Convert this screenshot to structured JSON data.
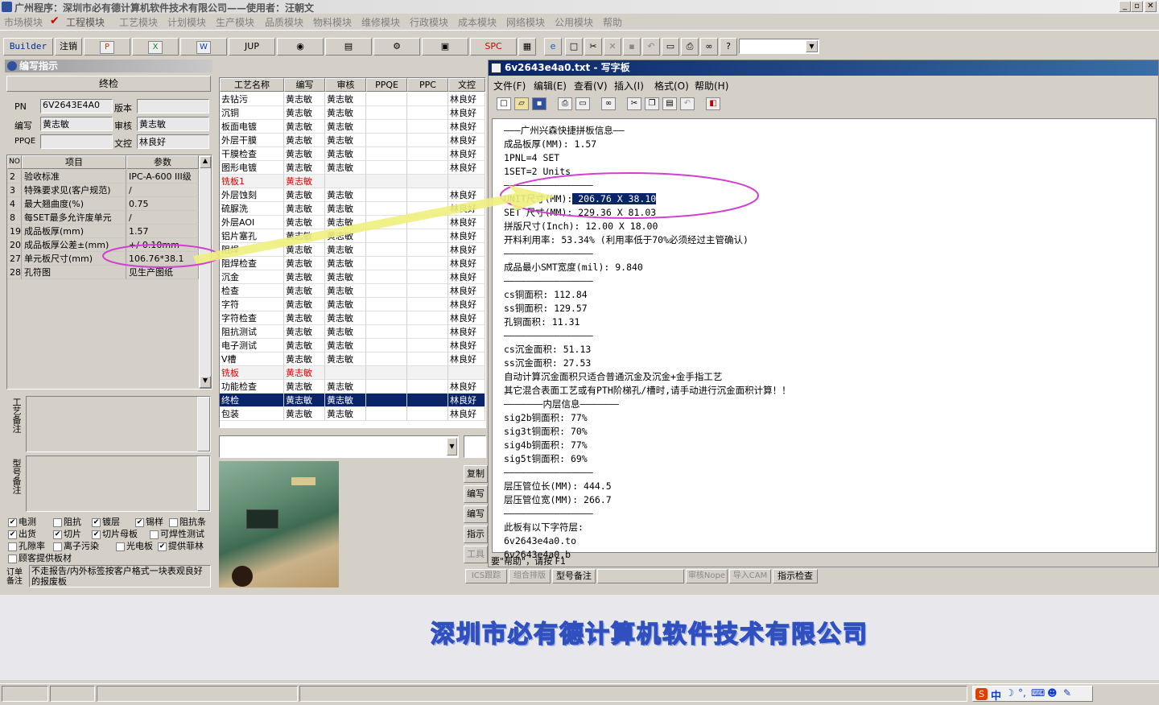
{
  "app": {
    "title": "广州程序：深圳市必有德计算机软件技术有限公司——使用者：汪朝文"
  },
  "menu": [
    "市场模块",
    "工程模块",
    "工艺模块",
    "计划模块",
    "生产模块",
    "品质模块",
    "物料模块",
    "维修模块",
    "行政模块",
    "成本模块",
    "网络模块",
    "公用模块",
    "帮助"
  ],
  "toolbar": {
    "builder": "Builder",
    "logout": "注销",
    "jup": "JUP",
    "spc": "SPC"
  },
  "left_panel": {
    "caption": "编写指示",
    "section": "终检",
    "pn_label": "PN",
    "pn_value": "6V2643E4A0",
    "version_label": "版本",
    "version_value": "",
    "writer_label": "编写",
    "writer_value": "黄志敏",
    "reviewer_label": "审核",
    "reviewer_value": "黄志敏",
    "ppqe_label": "PPQE",
    "ppqe_value": "",
    "docctl_label": "文控",
    "docctl_value": "林良好",
    "table_headers": [
      "NO",
      "项目",
      "参数"
    ],
    "rows": [
      {
        "no": "2",
        "item": "验收标准",
        "param": "IPC-A-600 III级"
      },
      {
        "no": "3",
        "item": "特殊要求见(客户规范)",
        "param": "/"
      },
      {
        "no": "4",
        "item": "最大翘曲度(%)",
        "param": "0.75"
      },
      {
        "no": "8",
        "item": "每SET最多允许废单元",
        "param": "/"
      },
      {
        "no": "19",
        "item": "成品板厚(mm)",
        "param": "1.57"
      },
      {
        "no": "20",
        "item": "成品板厚公差±(mm)",
        "param": "+/-0.10mm"
      },
      {
        "no": "27",
        "item": "单元板尺寸(mm)",
        "param": "106.76*38.1"
      },
      {
        "no": "28",
        "item": "孔符图",
        "param": "见生产图纸"
      }
    ],
    "process_note_label": "工艺备注",
    "model_note_label": "型号备注",
    "checkboxes": [
      {
        "label": "电测",
        "checked": true
      },
      {
        "label": "阻抗",
        "checked": false
      },
      {
        "label": "镀层",
        "checked": true
      },
      {
        "label": "锡样",
        "checked": true
      },
      {
        "label": "阻抗条",
        "checked": false
      },
      {
        "label": "出货",
        "checked": true
      },
      {
        "label": "切片",
        "checked": true
      },
      {
        "label": "切片母板",
        "checked": true
      },
      {
        "label": "可焊性测试",
        "checked": false
      },
      {
        "label": "孔隙率",
        "checked": false
      },
      {
        "label": "离子污染",
        "checked": false
      },
      {
        "label": "光电板",
        "checked": false
      },
      {
        "label": "提供菲林",
        "checked": true
      },
      {
        "label": "顾客提供板材",
        "checked": false
      }
    ],
    "order_note_label": "订单备注",
    "order_note": "不走报告/内外标签按客户格式一块表观良好的报废板"
  },
  "process_grid": {
    "headers": [
      "工艺名称",
      "编写",
      "审核",
      "PPQE",
      "PPC",
      "文控"
    ],
    "rows": [
      {
        "name": "去钻污",
        "w": "黄志敏",
        "r": "黄志敏",
        "d": "林良好"
      },
      {
        "name": "沉铜",
        "w": "黄志敏",
        "r": "黄志敏",
        "d": "林良好"
      },
      {
        "name": "板面电镀",
        "w": "黄志敏",
        "r": "黄志敏",
        "d": "林良好"
      },
      {
        "name": "外层干膜",
        "w": "黄志敏",
        "r": "黄志敏",
        "d": "林良好"
      },
      {
        "name": "干膜检查",
        "w": "黄志敏",
        "r": "黄志敏",
        "d": "林良好"
      },
      {
        "name": "图形电镀",
        "w": "黄志敏",
        "r": "黄志敏",
        "d": "林良好"
      },
      {
        "name": "铣板1",
        "w": "黄志敏",
        "r": "",
        "d": "",
        "red": true
      },
      {
        "name": "外层蚀刻",
        "w": "黄志敏",
        "r": "黄志敏",
        "d": "林良好"
      },
      {
        "name": "硫脲洗",
        "w": "黄志敏",
        "r": "黄志敏",
        "d": "林良好"
      },
      {
        "name": "外层AOI",
        "w": "黄志敏",
        "r": "黄志敏",
        "d": "林良好"
      },
      {
        "name": "铝片塞孔",
        "w": "黄志敏",
        "r": "黄志敏",
        "d": "林良好"
      },
      {
        "name": "阻焊",
        "w": "黄志敏",
        "r": "黄志敏",
        "d": "林良好"
      },
      {
        "name": "阻焊检查",
        "w": "黄志敏",
        "r": "黄志敏",
        "d": "林良好"
      },
      {
        "name": "沉金",
        "w": "黄志敏",
        "r": "黄志敏",
        "d": "林良好"
      },
      {
        "name": "检查",
        "w": "黄志敏",
        "r": "黄志敏",
        "d": "林良好"
      },
      {
        "name": "字符",
        "w": "黄志敏",
        "r": "黄志敏",
        "d": "林良好"
      },
      {
        "name": "字符检查",
        "w": "黄志敏",
        "r": "黄志敏",
        "d": "林良好"
      },
      {
        "name": "阻抗测试",
        "w": "黄志敏",
        "r": "黄志敏",
        "d": "林良好"
      },
      {
        "name": "电子测试",
        "w": "黄志敏",
        "r": "黄志敏",
        "d": "林良好"
      },
      {
        "name": "V槽",
        "w": "黄志敏",
        "r": "黄志敏",
        "d": "林良好"
      },
      {
        "name": "铣板",
        "w": "黄志敏",
        "r": "",
        "d": "",
        "red": true
      },
      {
        "name": "功能检查",
        "w": "黄志敏",
        "r": "黄志敏",
        "d": "林良好"
      },
      {
        "name": "终检",
        "w": "黄志敏",
        "r": "黄志敏",
        "d": "林良好",
        "selected": true
      },
      {
        "name": "包装",
        "w": "黄志敏",
        "r": "黄志敏",
        "d": "林良好"
      }
    ]
  },
  "side_buttons": [
    "复制",
    "编写",
    "编写",
    "指示",
    "工具"
  ],
  "bottom_tabs": [
    "ICS跟踪",
    "组合排版",
    "型号备注",
    "审核Nope",
    "导入CAM",
    "指示检查"
  ],
  "wordpad": {
    "title": "6v2643e4a0.txt - 写字板",
    "menu": [
      "文件(F)",
      "编辑(E)",
      "查看(V)",
      "插入(I)",
      "格式(O)",
      "帮助(H)"
    ],
    "lines": [
      "———广州兴森快捷拼板信息——",
      "成品板厚(MM): 1.57",
      "1PNL=4 SET",
      "1SET=2 Units",
      "————————————————",
      "UNIT尺寸(MM): 206.76 X 38.10",
      "SET 尺寸(MM): 229.36 X 81.03",
      "拼版尺寸(Inch): 12.00 X 18.00",
      "开料利用率: 53.34% (利用率低于70%必须经过主管确认)",
      "————————————————",
      "成品最小SMT宽度(mil): 9.840",
      "————————————————",
      "cs铜面积: 112.84",
      "ss铜面积: 129.57",
      "孔铜面积: 11.31",
      "————————————————",
      "cs沉金面积: 51.13",
      "ss沉金面积: 27.53",
      "自动计算沉金面积只适合普通沉金及沉金+金手指工艺",
      "其它混合表面工艺或有PTH阶梯孔/槽时,请手动进行沉金面积计算！！",
      "———————内层信息———————",
      "sig2b铜面积: 77%",
      "sig3t铜面积: 70%",
      "sig4b铜面积: 77%",
      "sig5t铜面积: 69%",
      "————————————————",
      "层压管位长(MM): 444.5",
      "层压管位宽(MM): 266.7",
      "————————————————",
      "此板有以下字符层:",
      "6v2643e4a0.to",
      "6v2643e4a0.b"
    ],
    "highlight_line": 5,
    "status": "要\"帮助\"，请按 F1"
  },
  "watermark": "深圳市必有德计算机软件技术有限公司",
  "tray": {
    "ime": "中"
  },
  "colors": {
    "selection": "#0a246a",
    "annotation": "#d040d0",
    "arrow": "#f0f080",
    "watermark": "#3050c0",
    "red_text": "#e00000"
  }
}
